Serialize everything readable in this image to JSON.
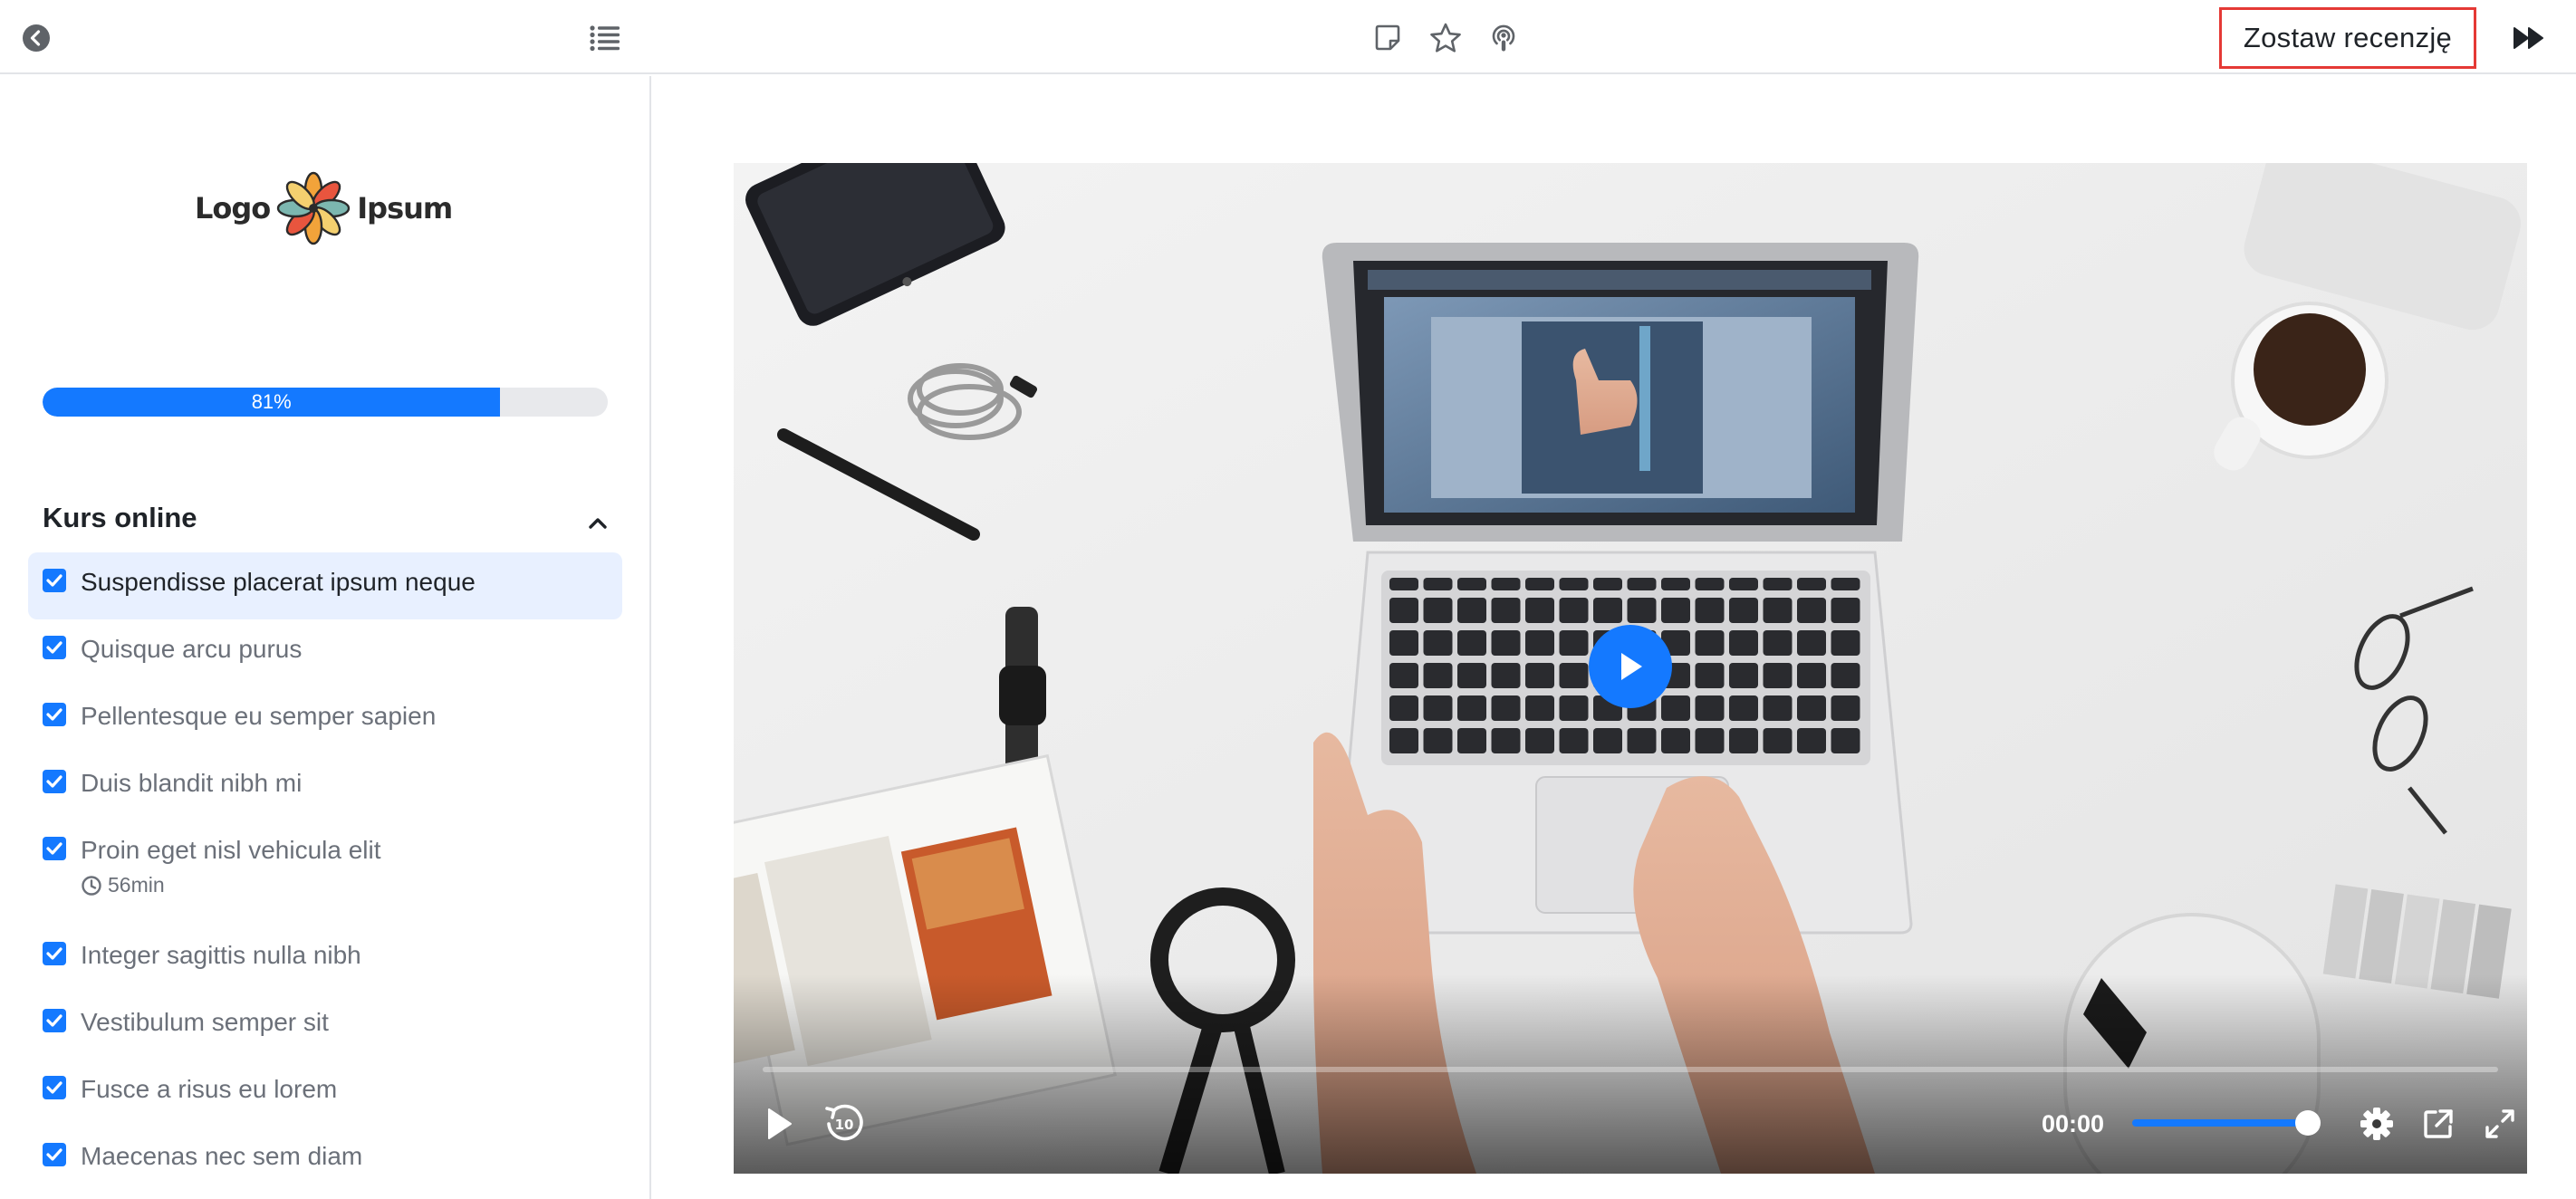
{
  "topbar": {
    "back_icon": "chevron-left-circle-icon",
    "menu_icon": "list-icon",
    "notes_icon": "sticky-note-icon",
    "star_icon": "star-icon",
    "podcast_icon": "podcast-icon",
    "review_label": "Zostaw recenzję",
    "next_icon": "fast-forward-icon"
  },
  "sidebar": {
    "logo": {
      "left": "Logo",
      "right": "Ipsum"
    },
    "progress": {
      "value": 81,
      "label": "81%"
    },
    "section_title": "Kurs online",
    "lessons": [
      {
        "title": "Suspendisse placerat ipsum neque",
        "active": true,
        "done": true
      },
      {
        "title": "Quisque arcu purus",
        "done": true
      },
      {
        "title": "Pellentesque eu semper sapien",
        "done": true
      },
      {
        "title": "Duis blandit nibh mi",
        "done": true
      },
      {
        "title": "Proin eget nisl vehicula elit",
        "duration": "56min",
        "done": true
      },
      {
        "title": "Integer sagittis nulla nibh",
        "done": true
      },
      {
        "title": "Vestibulum semper sit",
        "done": true
      },
      {
        "title": "Fusce a risus eu lorem",
        "done": true
      },
      {
        "title": "Maecenas nec sem diam",
        "done": true
      }
    ]
  },
  "player": {
    "current_time": "00:00",
    "volume": 1.0,
    "accent": "#1479ff"
  }
}
